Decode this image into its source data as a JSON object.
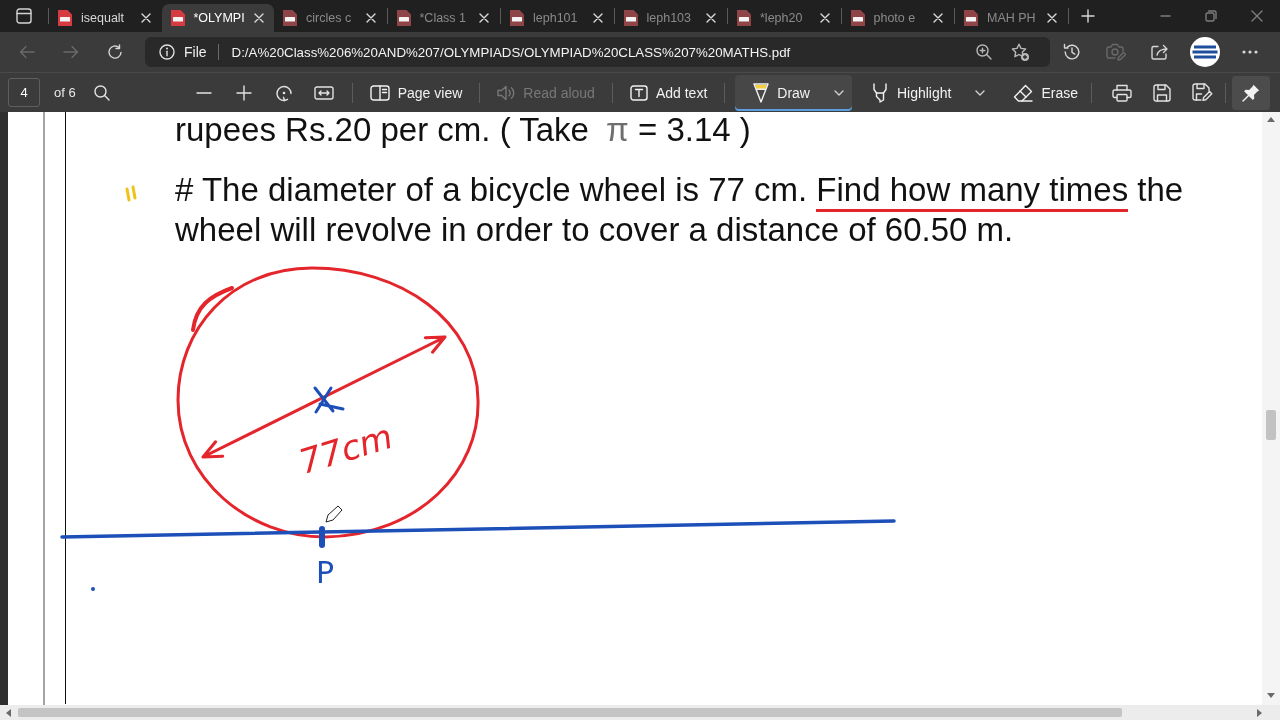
{
  "tabs": [
    {
      "label": "isequalt",
      "selected": false,
      "sleeping": false
    },
    {
      "label": "*OLYMPI",
      "selected": true,
      "sleeping": false
    },
    {
      "label": "circles c",
      "selected": false,
      "sleeping": true
    },
    {
      "label": "*Class 1",
      "selected": false,
      "sleeping": true
    },
    {
      "label": "leph101",
      "selected": false,
      "sleeping": true
    },
    {
      "label": "leph103",
      "selected": false,
      "sleeping": true
    },
    {
      "label": "*leph20",
      "selected": false,
      "sleeping": true
    },
    {
      "label": "photo e",
      "selected": false,
      "sleeping": true
    },
    {
      "label": "MAH PH",
      "selected": false,
      "sleeping": true
    }
  ],
  "address_bar": {
    "nav_buttons": [
      {
        "kind": "back",
        "disabled": true
      },
      {
        "kind": "forward",
        "disabled": true
      },
      {
        "kind": "refresh",
        "disabled": false
      }
    ],
    "scheme_label": "File",
    "url": "D:/A%20Class%206%20AND%207/OLYMPIADS/OLYMPIAD%20CLASS%207%20MATHS.pdf",
    "actions": [
      {
        "kind": "history",
        "disabled": false
      },
      {
        "kind": "capture",
        "disabled": true
      },
      {
        "kind": "share",
        "disabled": false
      }
    ]
  },
  "pdf_toolbar": {
    "page_number": "4",
    "page_count": "of 6",
    "tool_groups": [
      [
        {
          "kind": "page_view",
          "label": "Page view",
          "disabled": false,
          "selected": false,
          "dropdown": false
        }
      ],
      [
        {
          "kind": "read_aloud",
          "label": "Read aloud",
          "disabled": true,
          "selected": false,
          "dropdown": false
        }
      ],
      [
        {
          "kind": "add_text",
          "label": "Add text",
          "disabled": false,
          "selected": false,
          "dropdown": false
        }
      ],
      [
        {
          "kind": "draw",
          "label": "Draw",
          "disabled": false,
          "selected": true,
          "dropdown": true
        },
        {
          "kind": "highlight",
          "label": "Highlight",
          "disabled": false,
          "selected": false,
          "dropdown": true
        },
        {
          "kind": "erase",
          "label": "Erase",
          "disabled": false,
          "selected": false,
          "dropdown": false
        }
      ]
    ],
    "pinned": true
  },
  "page": {
    "paragraphs": [
      {
        "parts": [
          {
            "kind": "text",
            "text": "rupees Rs.20 per cm. ( Take ",
            "underlined": false
          },
          {
            "kind": "symbol",
            "text": "π",
            "underlined": false
          },
          {
            "kind": "text",
            "text": " = 3.14 )",
            "underlined": false
          }
        ]
      },
      {
        "parts": [
          {
            "kind": "text",
            "text": "# The diameter of a bicycle wheel is 77 cm. ",
            "underlined": false
          },
          {
            "kind": "text",
            "text": "Find how many times",
            "underlined": true
          },
          {
            "kind": "text",
            "text": " the wheel will revolve in order to cover a distance of 60.50 m.",
            "underlined": false
          }
        ]
      }
    ],
    "ink_labels": [
      {
        "text": "77cm",
        "color": "#e4252b"
      },
      {
        "text": "P",
        "color": "#1d4fb8"
      }
    ]
  }
}
